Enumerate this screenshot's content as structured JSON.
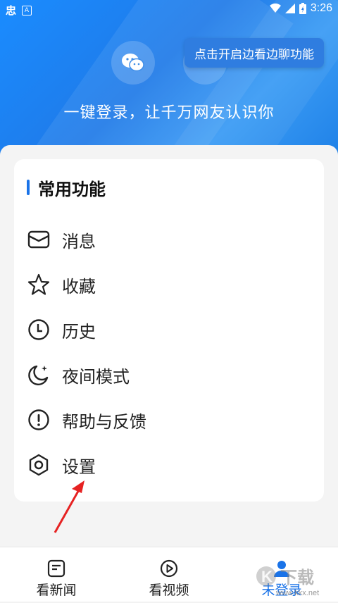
{
  "status_bar": {
    "time": "3:26"
  },
  "tooltip": "点击开启边看边聊功能",
  "slogan": "一键登录，让千万网友认识你",
  "section_title": "常用功能",
  "menu": [
    {
      "label": "消息",
      "icon": "mail-icon"
    },
    {
      "label": "收藏",
      "icon": "star-icon"
    },
    {
      "label": "历史",
      "icon": "clock-icon"
    },
    {
      "label": "夜间模式",
      "icon": "moon-icon"
    },
    {
      "label": "帮助与反馈",
      "icon": "exclamation-icon"
    },
    {
      "label": "设置",
      "icon": "hexagon-settings-icon"
    }
  ],
  "tabs": [
    {
      "label": "看新闻",
      "icon": "news-icon"
    },
    {
      "label": "看视频",
      "icon": "play-icon"
    },
    {
      "label": "未登录",
      "icon": "user-icon"
    }
  ],
  "watermark": "www.kkx.net",
  "colors": {
    "accent": "#1a73e8",
    "hero": "#1f7ae8"
  }
}
